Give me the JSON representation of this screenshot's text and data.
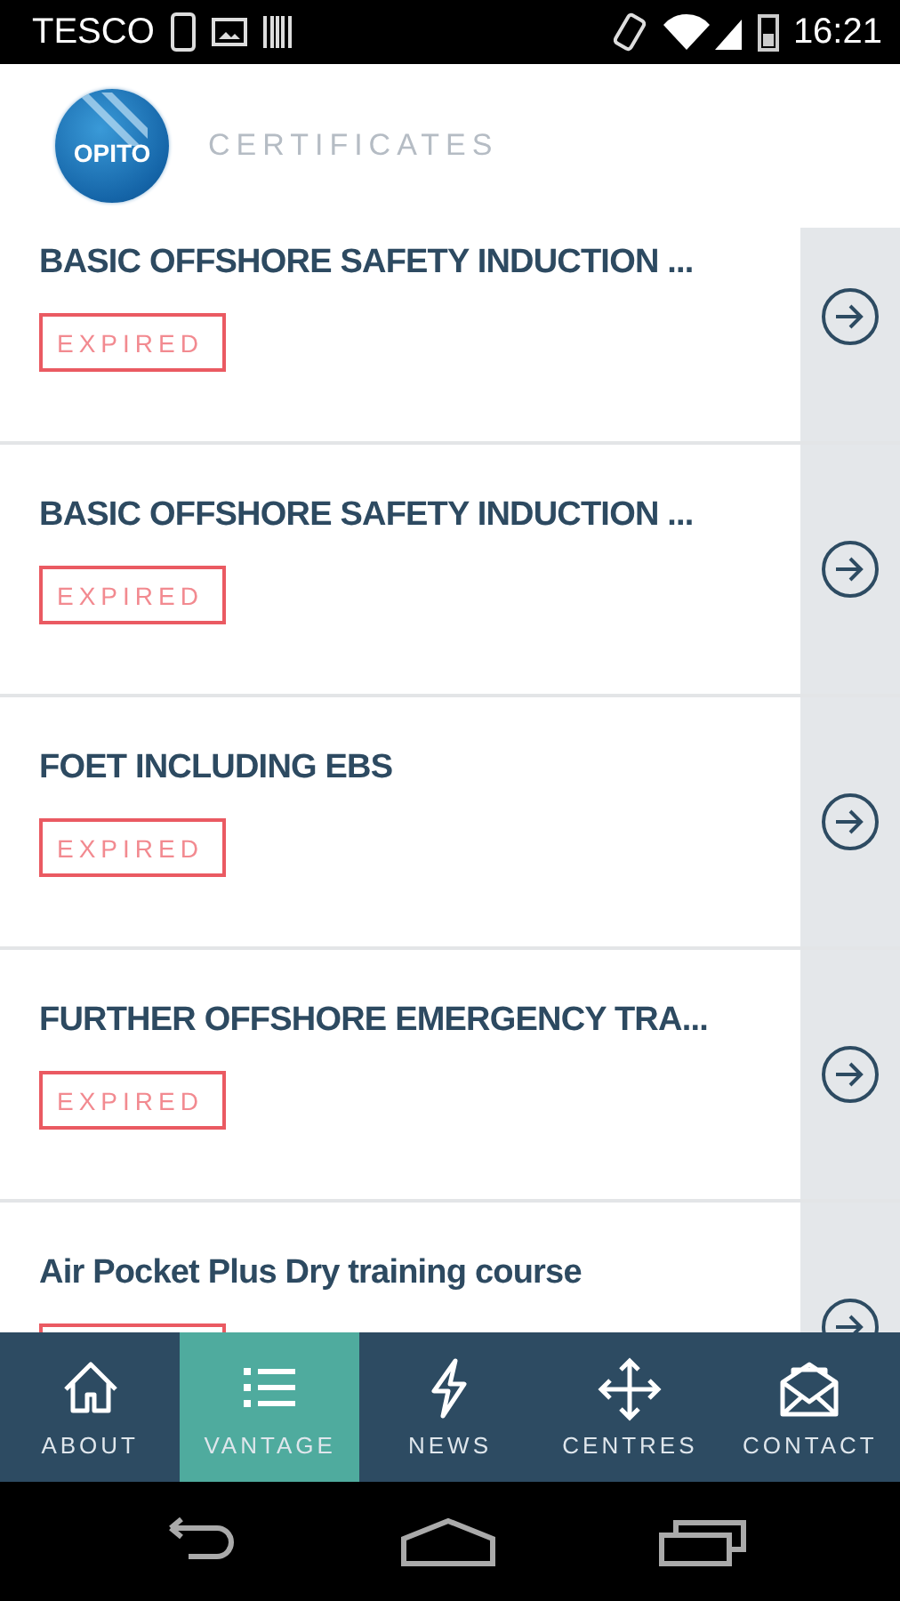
{
  "status_bar": {
    "carrier": "TESCO",
    "time": "16:21"
  },
  "header": {
    "logo": "OPITO",
    "title": "CERTIFICATES"
  },
  "certificates": [
    {
      "title": "BASIC OFFSHORE SAFETY INDUCTION ...",
      "kind": "full",
      "status": "EXPIRED"
    },
    {
      "title": "BASIC OFFSHORE SAFETY INDUCTION ...",
      "kind": "full",
      "status": "EXPIRED"
    },
    {
      "title": "FOET INCLUDING EBS",
      "kind": "full",
      "status": "EXPIRED"
    },
    {
      "title": "FURTHER OFFSHORE EMERGENCY TRA...",
      "kind": "full",
      "status": "EXPIRED"
    },
    {
      "title": "Air Pocket Plus Dry training course",
      "kind": "partial"
    }
  ],
  "nav": [
    {
      "label": "ABOUT",
      "selected": false
    },
    {
      "label": "VANTAGE",
      "selected": true
    },
    {
      "label": "NEWS",
      "selected": false
    },
    {
      "label": "CENTRES",
      "selected": false
    },
    {
      "label": "CONTACT",
      "selected": false
    }
  ]
}
